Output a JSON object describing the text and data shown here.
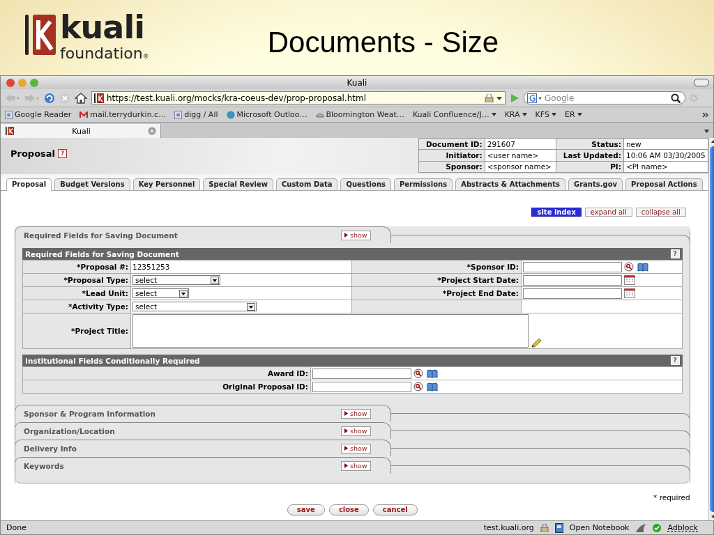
{
  "slide": {
    "logo_name": "kuali",
    "logo_sub": "foundation",
    "logo_mark": "®",
    "title": "Documents - Size"
  },
  "browser": {
    "title": "Kuali",
    "url": "https://test.kuali.org/mocks/kra-coeus-dev/prop-proposal.html",
    "search_placeholder": "Google",
    "bookmarks": [
      {
        "label": "Google Reader",
        "kind": "link"
      },
      {
        "label": "mail.terrydurkin.c…",
        "kind": "mail"
      },
      {
        "label": "digg / All",
        "kind": "link"
      },
      {
        "label": "Microsoft Outloo…",
        "kind": "globe"
      },
      {
        "label": "Bloomington Weat…",
        "kind": "cloud"
      },
      {
        "label": "Kuali Confluence/J…",
        "kind": "menu"
      },
      {
        "label": "KRA",
        "kind": "menu"
      },
      {
        "label": "KFS",
        "kind": "menu"
      },
      {
        "label": "ER",
        "kind": "menu"
      }
    ],
    "tab_title": "Kuali"
  },
  "document": {
    "title": "Proposal",
    "help": "?",
    "info": [
      {
        "label": "Document ID:",
        "value": "291607",
        "label2": "Status:",
        "value2": "new"
      },
      {
        "label": "Initiator:",
        "value": "<user name>",
        "label2": "Last Updated:",
        "value2": "10:06 AM 03/30/2005"
      },
      {
        "label": "Sponsor:",
        "value": "<sponsor name>",
        "label2": "PI:",
        "value2": "<PI name>"
      }
    ]
  },
  "tabs": [
    {
      "label": "Proposal",
      "selected": true
    },
    {
      "label": "Budget Versions",
      "selected": false
    },
    {
      "label": "Key Personnel",
      "selected": false
    },
    {
      "label": "Special Review",
      "selected": false
    },
    {
      "label": "Custom Data",
      "selected": false
    },
    {
      "label": "Questions",
      "selected": false
    },
    {
      "label": "Permissions",
      "selected": false
    },
    {
      "label": "Abstracts & Attachments",
      "selected": false
    },
    {
      "label": "Grants.gov",
      "selected": false
    },
    {
      "label": "Proposal Actions",
      "selected": false
    }
  ],
  "actions": [
    {
      "label": "site index",
      "kind": "primary"
    },
    {
      "label": "expand all",
      "kind": "plain"
    },
    {
      "label": "collapse all",
      "kind": "plain"
    }
  ],
  "sections": [
    {
      "title": "Required Fields for Saving Document",
      "button": "show",
      "panels": [
        {
          "title": "Required Fields for Saving Document",
          "help": "?",
          "kind": "two-column",
          "rows": [
            {
              "label": "*Proposal #:",
              "field": {
                "kind": "text",
                "value": "12351253"
              },
              "label2": "*Sponsor ID:",
              "field2": {
                "kind": "lookup"
              }
            },
            {
              "label": "*Proposal Type:",
              "field": {
                "kind": "select",
                "value": "select"
              },
              "label2": "*Project Start Date:",
              "field2": {
                "kind": "date"
              }
            },
            {
              "label": "*Lead Unit:",
              "field": {
                "kind": "select",
                "value": "select"
              },
              "label2": "*Project End Date:",
              "field2": {
                "kind": "date"
              }
            },
            {
              "label": "*Activity Type:",
              "field": {
                "kind": "select",
                "value": "select"
              }
            },
            {
              "label": "*Project Title:",
              "field": {
                "kind": "textarea"
              }
            }
          ]
        },
        {
          "title": "Institutional Fields Conditionally Required",
          "help": "?",
          "kind": "one-column",
          "rows": [
            {
              "label": "Award ID:",
              "field": {
                "kind": "lookup"
              }
            },
            {
              "label": "Original Proposal ID:",
              "field": {
                "kind": "lookup"
              }
            }
          ]
        }
      ]
    },
    {
      "title": "Sponsor & Program Information",
      "button": "show"
    },
    {
      "title": "Organization/Location",
      "button": "show"
    },
    {
      "title": "Delivery Info",
      "button": "show"
    },
    {
      "title": "Keywords",
      "button": "show"
    }
  ],
  "required_note": "* required",
  "buttons": [
    "save",
    "close",
    "cancel"
  ],
  "status": {
    "text": "Done",
    "host": "test.kuali.org",
    "notebook": "Open Notebook",
    "adblock": "Adblock"
  }
}
